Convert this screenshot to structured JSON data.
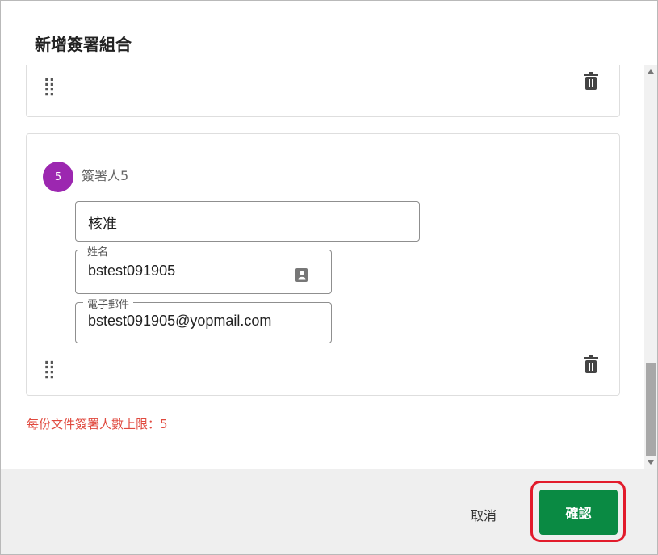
{
  "dialog": {
    "title": "新增簽署組合"
  },
  "signers": [
    {
      "index": "5",
      "label": "簽署人5",
      "role": "核准",
      "name_label": "姓名",
      "name": "bstest091905",
      "email_label": "電子郵件",
      "email": "bstest091905@yopmail.com"
    }
  ],
  "icons": {
    "drag": "⣿",
    "trash": "trash-icon",
    "contact": "contact-icon"
  },
  "limit_text": "每份文件簽署人數上限：5",
  "footer": {
    "cancel_label": "取消",
    "confirm_label": "確認"
  },
  "colors": {
    "accent": "#0a8a43",
    "badge": "#9c27b0",
    "error": "#e04a3f",
    "highlight": "#e21b2b"
  }
}
